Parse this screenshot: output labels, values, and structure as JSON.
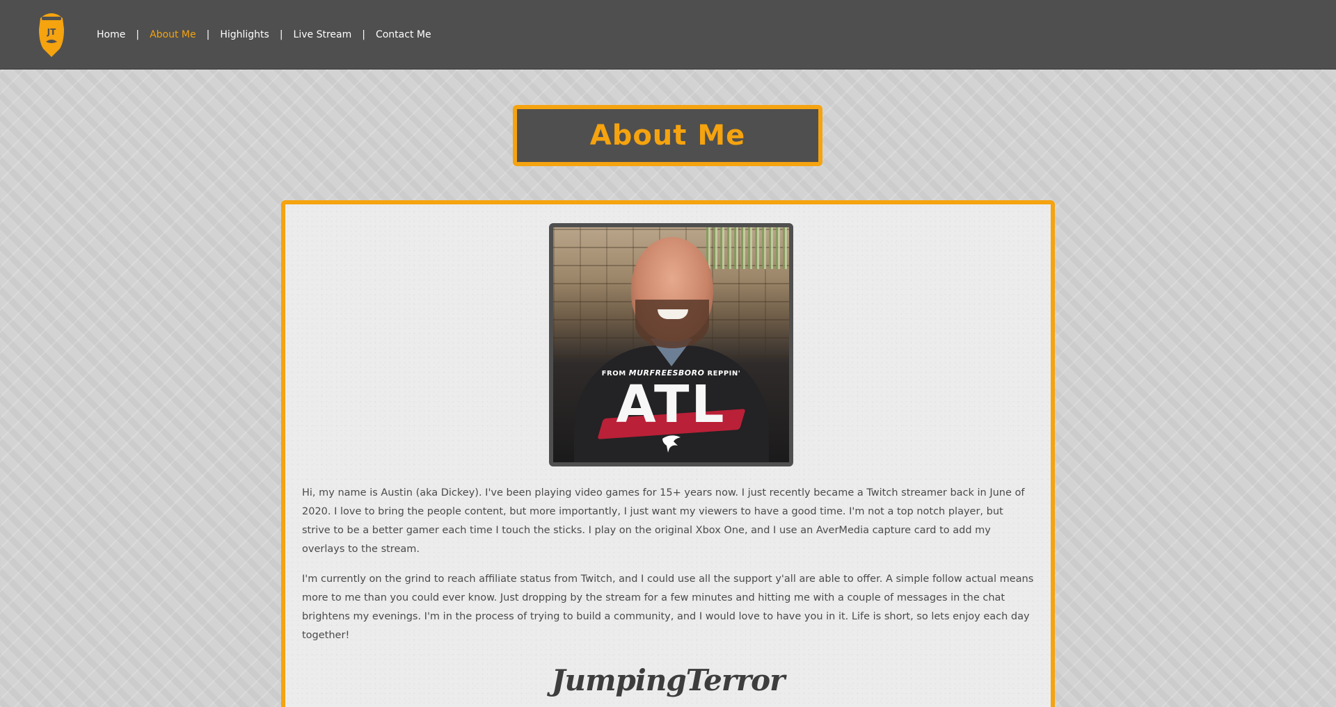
{
  "nav": {
    "logo_text": "JT",
    "items": [
      {
        "label": "Home"
      },
      {
        "label": "About Me"
      },
      {
        "label": "Highlights"
      },
      {
        "label": "Live Stream"
      },
      {
        "label": "Contact Me"
      }
    ],
    "separator": "|",
    "active_index": 1
  },
  "page": {
    "title": "About Me"
  },
  "photo": {
    "shirt_from": "FROM",
    "shirt_city": "MURFREESBORO",
    "shirt_reppin": "REPPIN'",
    "shirt_big": "ATL"
  },
  "bio": {
    "paragraph_1": "Hi, my name is Austin (aka Dickey). I've been playing video games for 15+ years now. I just recently became a Twitch streamer back in June of 2020. I love to bring the people content, but more importantly, I just want my viewers to have a good time. I'm not a top notch player, but strive to be a better gamer each time I touch the sticks. I play on the original Xbox One, and I use an AverMedia capture card to add my overlays to the stream.",
    "paragraph_2": "I'm currently on the grind to reach affiliate status from Twitch, and I could use all the support y'all are able to offer. A simple follow actual means more to me than you could ever know. Just dropping by the stream for a few minutes and hitting me with a couple of messages in the chat brightens my evenings. I'm in the process of trying to build a community, and I would love to have you in it. Life is short, so lets enjoy each day together!",
    "signature": "JumpingTerror"
  },
  "colors": {
    "accent": "#f5a30f",
    "nav_bg": "#4f4f4f",
    "text": "#4a4a4a"
  }
}
